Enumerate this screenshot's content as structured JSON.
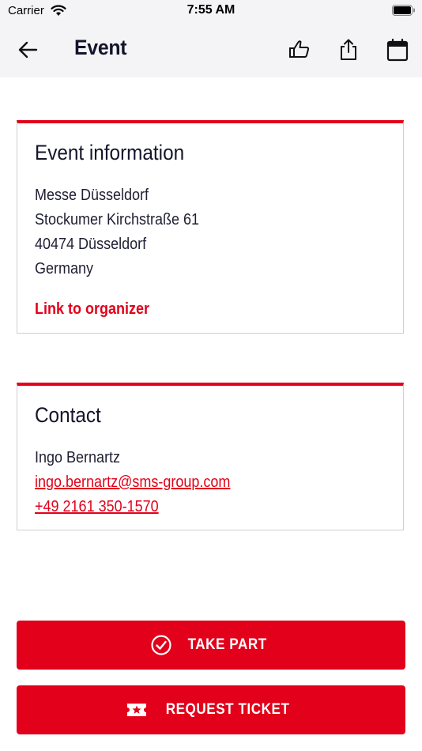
{
  "status_bar": {
    "carrier": "Carrier",
    "time": "7:55 AM"
  },
  "nav": {
    "title": "Event",
    "icons": [
      "back-arrow-icon",
      "thumbs-up-icon",
      "share-icon",
      "calendar-icon"
    ]
  },
  "event_information": {
    "heading": "Event information",
    "address_lines": [
      "Messe Düsseldorf",
      "Stockumer Kirchstraße 61",
      "40474 Düsseldorf",
      "Germany"
    ],
    "organizer_link": "Link to organizer"
  },
  "contact": {
    "heading": "Contact",
    "name": "Ingo Bernartz",
    "email": "ingo.bernartz@sms-group.com",
    "phone": "+49 2161 350-1570"
  },
  "actions": {
    "take_part": "TAKE PART",
    "request_ticket": "REQUEST TICKET"
  },
  "colors": {
    "accent": "#e2001a",
    "nav_background": "#f4f4f7",
    "text": "#14142b",
    "card_border": "#cfcfd4"
  }
}
